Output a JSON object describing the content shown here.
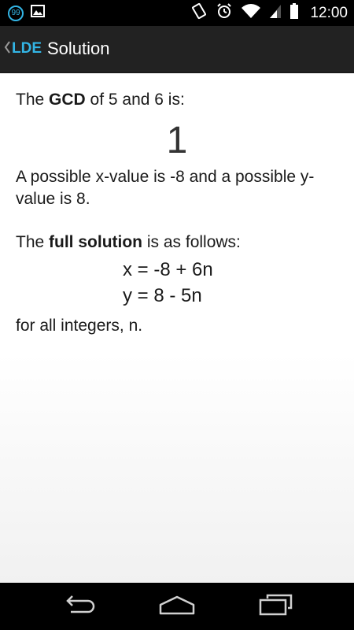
{
  "status_bar": {
    "notification_count": "99",
    "time": "12:00"
  },
  "action_bar": {
    "app_name": "LDE",
    "title": "Solution"
  },
  "solution": {
    "gcd_prefix": "The ",
    "gcd_keyword": "GCD",
    "gcd_suffix": " of 5 and 6 is:",
    "gcd_value": "1",
    "possible_values": "A possible x-value is -8 and a possible y-value is 8.",
    "full_prefix": "The ",
    "full_keyword": "full solution",
    "full_suffix": " is as follows:",
    "equation_x": "x = -8 + 6n",
    "equation_y": "y = 8 - 5n",
    "footer": "for all integers, n."
  },
  "colors": {
    "accent": "#33b5e5",
    "action_bar": "#222222",
    "status_bar": "#000000"
  }
}
